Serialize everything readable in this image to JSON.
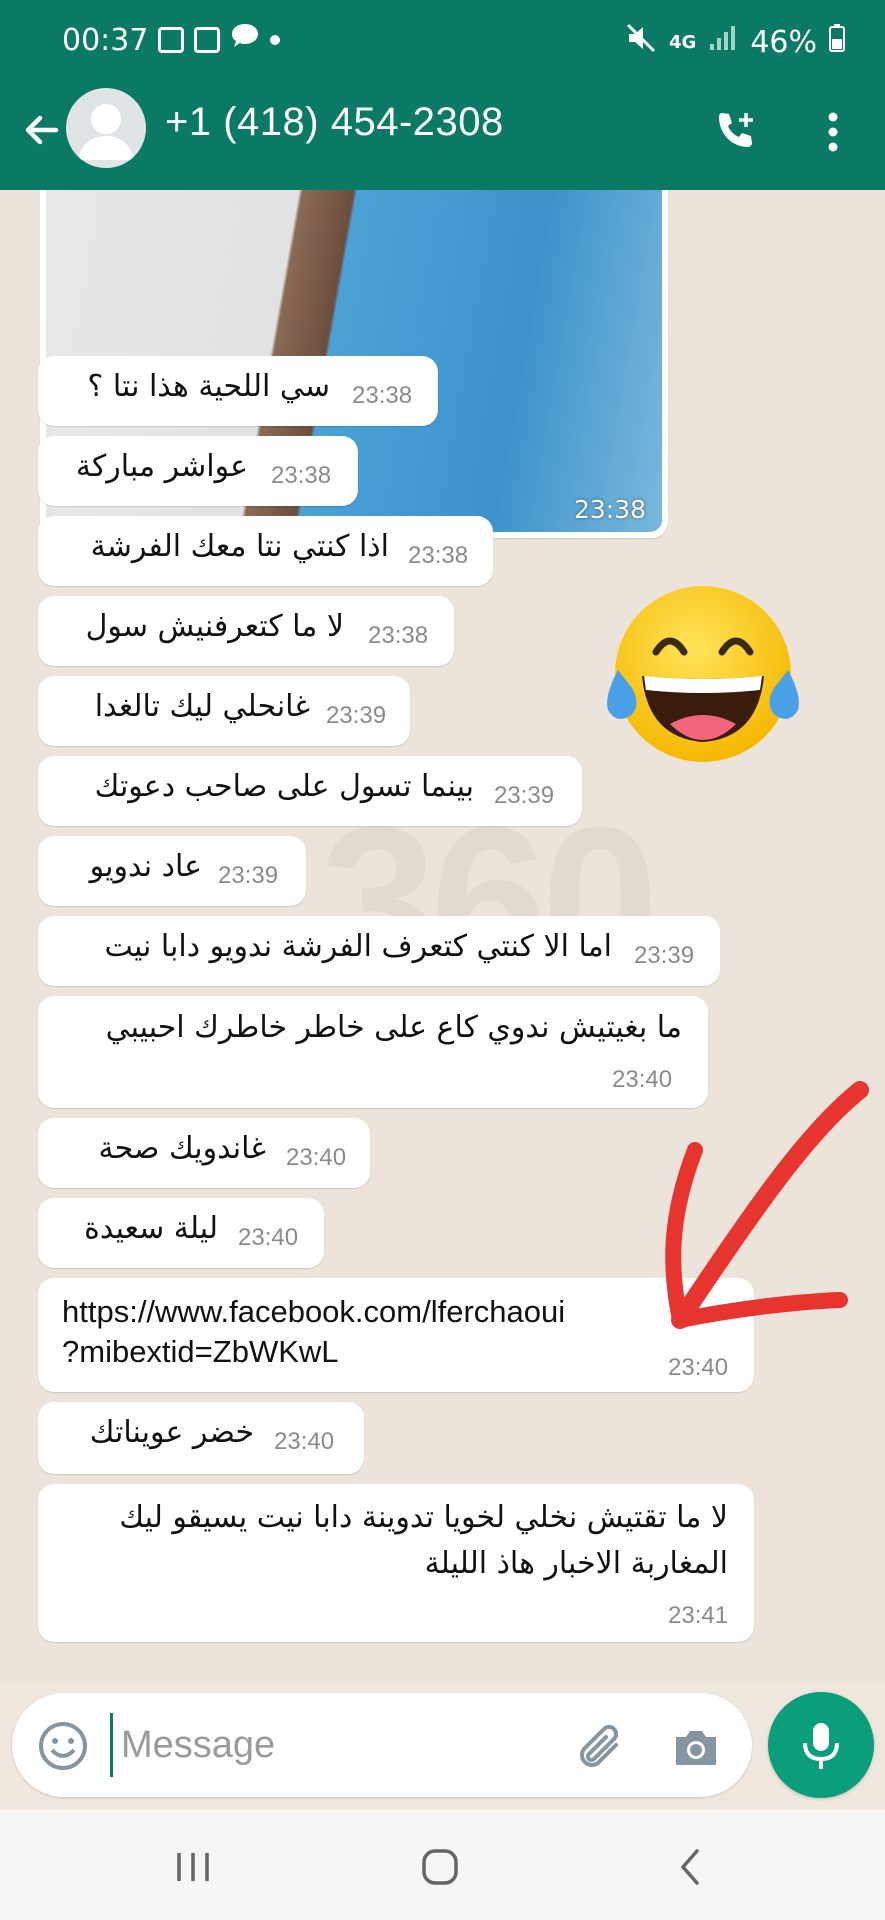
{
  "status_bar": {
    "time": "00:37",
    "network": "4G",
    "battery": "46%",
    "icons": [
      "gallery-icon",
      "news-icon",
      "chat-icon",
      "dot-icon",
      "mute-icon",
      "signal-icon",
      "battery-icon"
    ]
  },
  "header": {
    "contact_name": "+1 (418) 454-2308",
    "brand_color": "#0a7a65"
  },
  "chat": {
    "watermark": "360",
    "image_message": {
      "time": "23:38"
    },
    "messages": [
      {
        "text": "سي اللحية هذا نتا ؟",
        "time": "23:38"
      },
      {
        "text": "عواشر مباركة",
        "time": "23:38"
      },
      {
        "text": "اذا كنتي نتا معك الفرشة",
        "time": "23:38"
      },
      {
        "text": "لا ما كتعرفنيش سول",
        "time": "23:38"
      },
      {
        "text": "غانحلي ليك تالغدا",
        "time": "23:39"
      },
      {
        "text": "بينما تسول على صاحب دعوتك",
        "time": "23:39"
      },
      {
        "text": "عاد ندويو",
        "time": "23:39"
      },
      {
        "text": "اما الا كنتي كتعرف الفرشة ندويو دابا نيت",
        "time": "23:39"
      },
      {
        "text": "ما بغيتيش ندوي كاع على خاطر خاطرك احبيبي",
        "time": "23:40"
      },
      {
        "text": "غاندويك صحة",
        "time": "23:40"
      },
      {
        "text": "ليلة سعيدة",
        "time": "23:40"
      },
      {
        "text_line1": "https://www.facebook.com/lferchaoui",
        "text_line2": "?mibextid=ZbWKwL",
        "time": "23:40"
      },
      {
        "text": "خضر عويناتك",
        "time": "23:40"
      },
      {
        "text_line1": "لا ما تقتيش نخلي لخويا تدوينة دابا نيت يسيقو ليك",
        "text_line2": "المغاربة الاخبار هاذ الليلة",
        "time": "23:41"
      }
    ]
  },
  "composer": {
    "placeholder": "Message",
    "accent_color": "#0a9e7b"
  },
  "nav": {
    "buttons": [
      "recents-button",
      "home-button",
      "back-button"
    ]
  }
}
